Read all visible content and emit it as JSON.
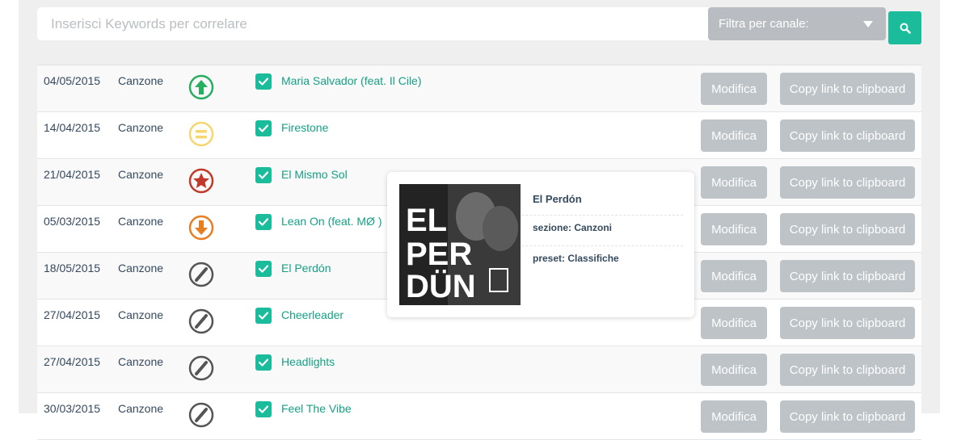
{
  "search": {
    "placeholder": "Inserisci Keywords per correlare"
  },
  "filter": {
    "label": "Filtra per canale:"
  },
  "colors": {
    "accent": "#1abc9c",
    "link": "#16a085",
    "button_gray": "#bdc3c7",
    "text": "#34495e"
  },
  "rows": [
    {
      "date": "04/05/2015",
      "type": "Canzone",
      "trend": "up-arrow-icon",
      "title": "Maria Salvador (feat. Il Cile)",
      "edit_label": "Modifica",
      "copy_label": "Copy link to clipboard"
    },
    {
      "date": "14/04/2015",
      "type": "Canzone",
      "trend": "equal-icon",
      "title": "Firestone",
      "edit_label": "Modifica",
      "copy_label": "Copy link to clipboard"
    },
    {
      "date": "21/04/2015",
      "type": "Canzone",
      "trend": "star-icon",
      "title": "El Mismo Sol",
      "edit_label": "Modifica",
      "copy_label": "Copy link to clipboard"
    },
    {
      "date": "05/03/2015",
      "type": "Canzone",
      "trend": "down-arrow-icon",
      "title": "Lean On (feat. MØ )",
      "edit_label": "Modifica",
      "copy_label": "Copy link to clipboard"
    },
    {
      "date": "18/05/2015",
      "type": "Canzone",
      "trend": "no-data-icon",
      "title": "El Perdón",
      "edit_label": "Modifica",
      "copy_label": "Copy link to clipboard"
    },
    {
      "date": "27/04/2015",
      "type": "Canzone",
      "trend": "no-data-icon",
      "title": "Cheerleader",
      "edit_label": "Modifica",
      "copy_label": "Copy link to clipboard"
    },
    {
      "date": "27/04/2015",
      "type": "Canzone",
      "trend": "no-data-icon",
      "title": "Headlights",
      "edit_label": "Modifica",
      "copy_label": "Copy link to clipboard"
    },
    {
      "date": "30/03/2015",
      "type": "Canzone",
      "trend": "no-data-icon",
      "title": "Feel The Vibe",
      "edit_label": "Modifica",
      "copy_label": "Copy link to clipboard"
    }
  ],
  "popover": {
    "title": "El Perdón",
    "section": "sezione: Canzoni",
    "preset": "preset: Classifiche",
    "cover_text": [
      "EL",
      "PER",
      "DÜN"
    ]
  }
}
